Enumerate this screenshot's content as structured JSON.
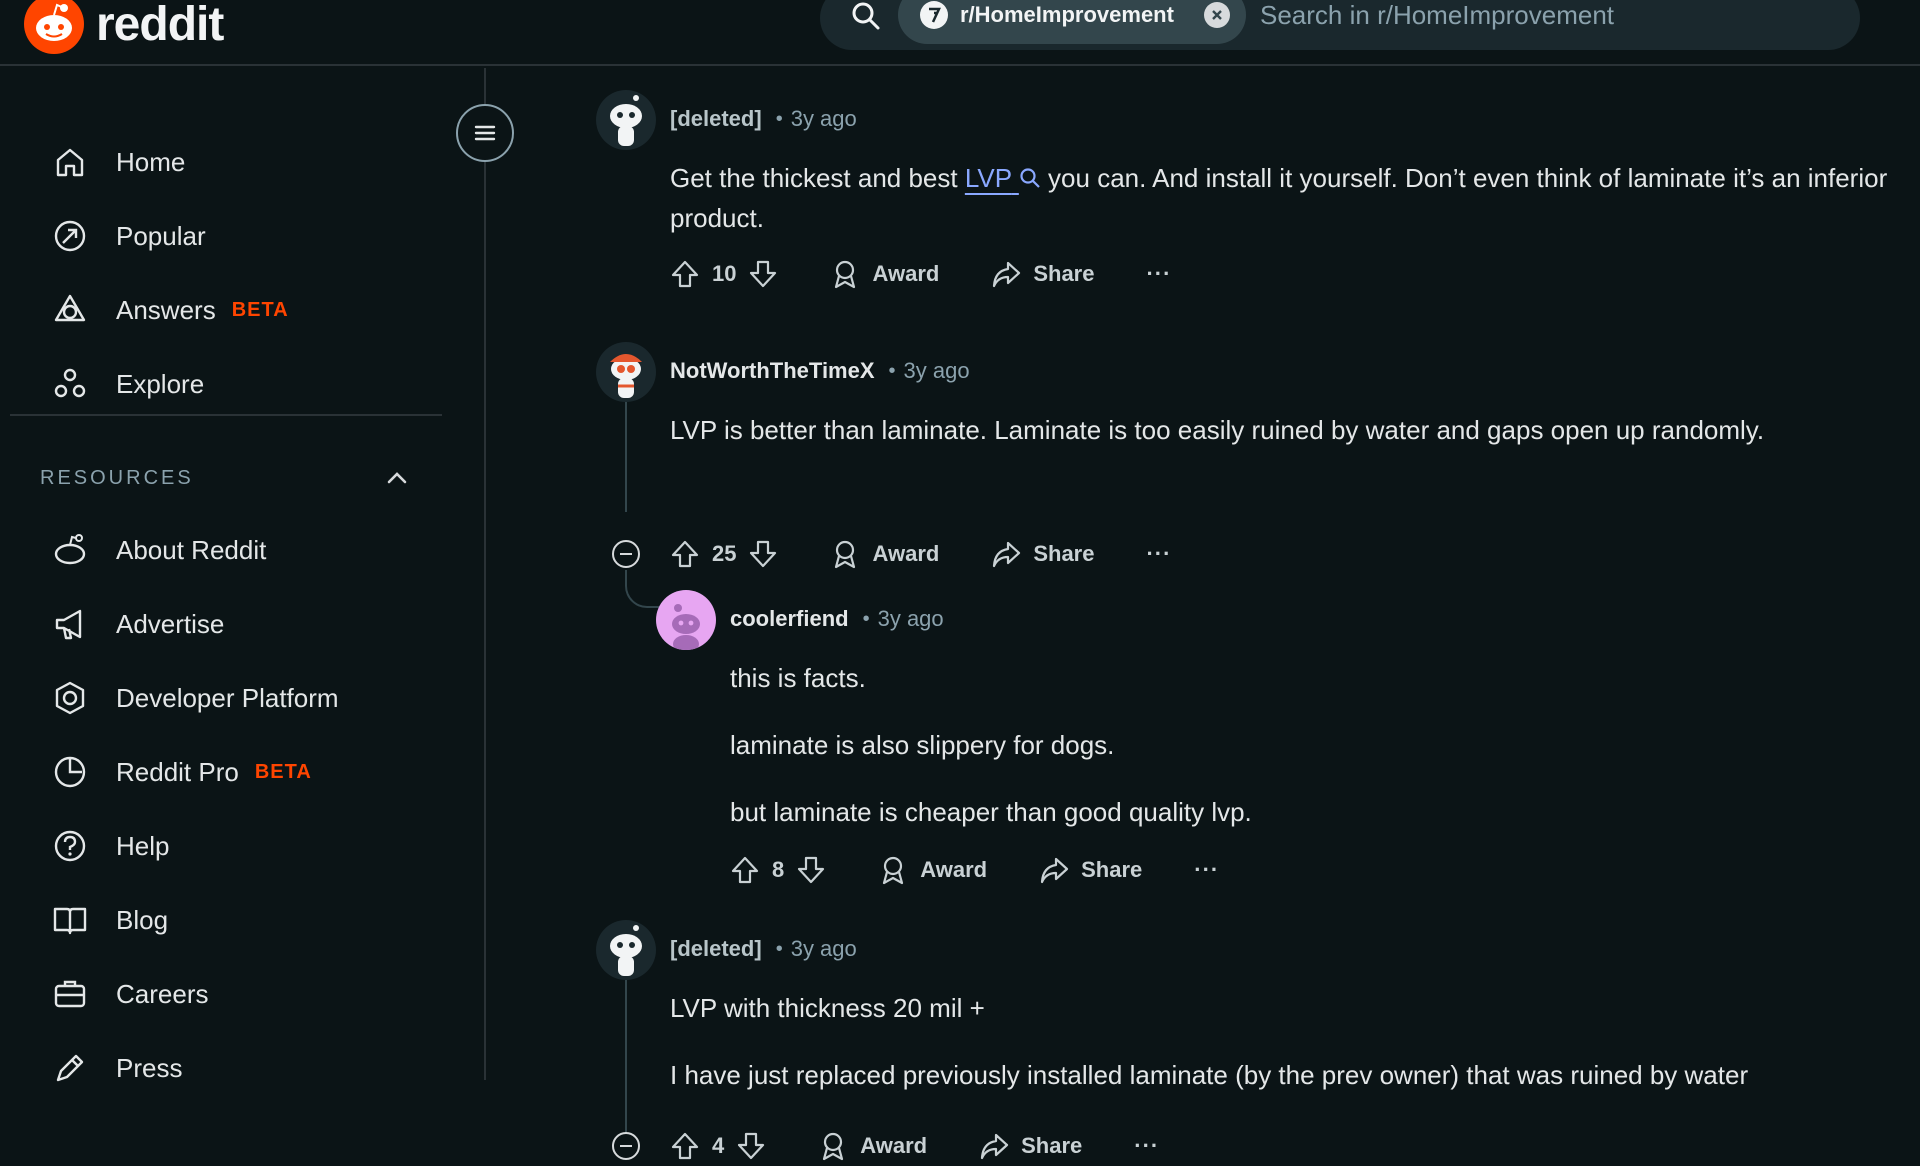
{
  "header": {
    "logo_text": "reddit",
    "community": "r/HomeImprovement",
    "search_placeholder": "Search in r/HomeImprovement"
  },
  "sidebar": {
    "nav": [
      {
        "label": "Home",
        "icon": "home-icon"
      },
      {
        "label": "Popular",
        "icon": "popular-icon"
      },
      {
        "label": "Answers",
        "icon": "answers-icon",
        "badge": "BETA"
      },
      {
        "label": "Explore",
        "icon": "explore-icon"
      }
    ],
    "resources_title": "RESOURCES",
    "resources": [
      {
        "label": "About Reddit",
        "icon": "reddit-alien-icon"
      },
      {
        "label": "Advertise",
        "icon": "megaphone-icon"
      },
      {
        "label": "Developer Platform",
        "icon": "developer-platform-icon"
      },
      {
        "label": "Reddit Pro",
        "icon": "reddit-pro-icon",
        "badge": "BETA"
      },
      {
        "label": "Help",
        "icon": "help-icon"
      },
      {
        "label": "Blog",
        "icon": "book-icon"
      },
      {
        "label": "Careers",
        "icon": "briefcase-icon"
      },
      {
        "label": "Press",
        "icon": "pen-icon"
      }
    ]
  },
  "comments": [
    {
      "author": "[deleted]",
      "time": "3y ago",
      "body_pre": "Get the thickest and best ",
      "link": "LVP",
      "body_post": " you can. And install it yourself. Don’t even think of laminate it’s an inferior product.",
      "votes": "10"
    },
    {
      "author": "NotWorthTheTimeX",
      "time": "3y ago",
      "body": "LVP is better than laminate. Laminate is too easily ruined by water and gaps open up randomly.",
      "votes": "25"
    },
    {
      "author": "coolerfiend",
      "time": "3y ago",
      "paragraphs": [
        "this is facts.",
        "laminate is also slippery for dogs.",
        "but laminate is cheaper than good quality lvp."
      ],
      "votes": "8"
    },
    {
      "author": "[deleted]",
      "time": "3y ago",
      "paragraphs": [
        "LVP with thickness 20 mil +",
        "I have just replaced previously installed laminate (by the prev owner) that was ruined by water"
      ],
      "votes": "4"
    }
  ],
  "actions": {
    "award": "Award",
    "share": "Share",
    "more": "···",
    "dot": "•"
  },
  "colors": {
    "brand": "#ff4500",
    "background": "#0b1416",
    "link": "#8aa8ff"
  }
}
